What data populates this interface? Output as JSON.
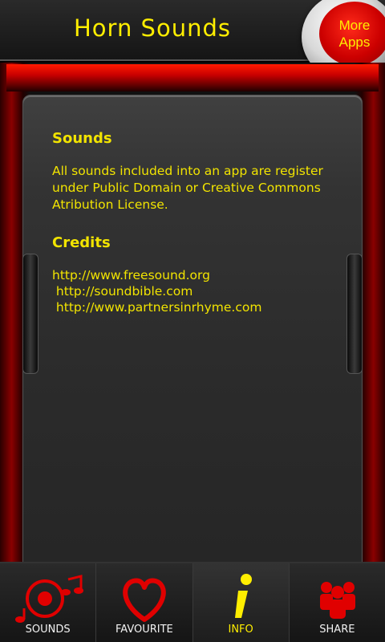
{
  "header": {
    "title": "Horn Sounds",
    "more_apps_line1": "More",
    "more_apps_line2": "Apps"
  },
  "content": {
    "sounds_heading": "Sounds",
    "sounds_text": "All sounds included into an app are register\nunder Public Domain or Creative Commons\nAtribution License.",
    "credits_heading": "Credits",
    "links": [
      "http://www.freesound.org",
      " http://soundbible.com",
      " http://www.partnersinrhyme.com"
    ]
  },
  "nav": {
    "items": [
      {
        "label": "SOUNDS",
        "icon": "music-disc-icon"
      },
      {
        "label": "FAVOURITE",
        "icon": "heart-icon"
      },
      {
        "label": "INFO",
        "icon": "info-icon"
      },
      {
        "label": "SHARE",
        "icon": "people-icon"
      }
    ],
    "active_index": 2
  },
  "colors": {
    "accent_yellow": "#ffee00",
    "accent_red": "#e00000"
  }
}
